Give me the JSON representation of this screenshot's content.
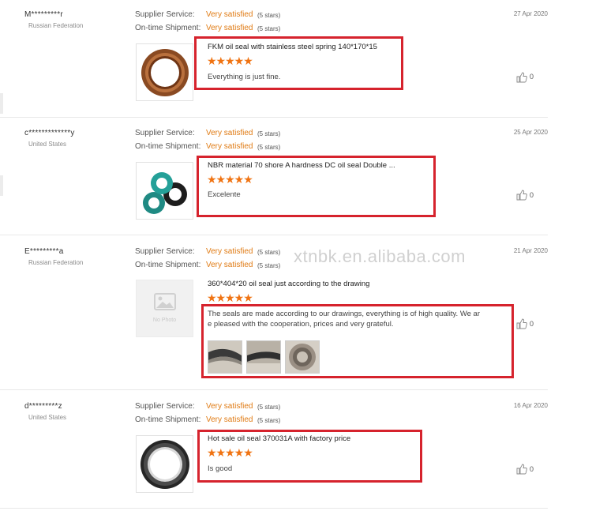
{
  "labels": {
    "supplier_service": "Supplier Service:",
    "ontime_shipment": "On-time Shipment:",
    "no_photo": "No Photo"
  },
  "watermark": "xtnbk.en.alibaba.com",
  "colors": {
    "accent": "#e07b14",
    "stars": "#f07312",
    "highlight": "#d6232d"
  },
  "reviews": [
    {
      "buyer": "M*********r",
      "country": "Russian Federation",
      "supplier_rating": "Very satisfied",
      "supplier_stars": "(5 stars)",
      "shipment_rating": "Very satisfied",
      "shipment_stars": "(5 stars)",
      "date": "27 Apr 2020",
      "product": "FKM oil seal with stainless steel spring 140*170*15",
      "rating": 5,
      "stars_text": "★★★★★",
      "comment": "Everything is just fine.",
      "likes": "0",
      "image_icon": "brown-oil-seal-photo"
    },
    {
      "buyer": "c*************y",
      "country": "United States",
      "supplier_rating": "Very satisfied",
      "supplier_stars": "(5 stars)",
      "shipment_rating": "Very satisfied",
      "shipment_stars": "(5 stars)",
      "date": "25 Apr 2020",
      "product": "NBR material 70 shore A hardness DC oil seal Double ...",
      "rating": 5,
      "stars_text": "★★★★★",
      "comment": "Excelente",
      "likes": "0",
      "image_icon": "green-oil-seals-photo"
    },
    {
      "buyer": "E*********a",
      "country": "Russian Federation",
      "supplier_rating": "Very satisfied",
      "supplier_stars": "(5 stars)",
      "shipment_rating": "Very satisfied",
      "shipment_stars": "(5 stars)",
      "date": "21 Apr 2020",
      "product": "360*404*20 oil seal just according to the drawing",
      "rating": 5,
      "stars_text": "★★★★★",
      "comment_line1": "The seals are made according to our drawings, everything is of high quality. We ar",
      "comment_line2": "e pleased with the cooperation, prices and very grateful.",
      "likes": "0",
      "image_icon": "no-photo-placeholder"
    },
    {
      "buyer": "d*********z",
      "country": "United States",
      "supplier_rating": "Very satisfied",
      "supplier_stars": "(5 stars)",
      "shipment_rating": "Very satisfied",
      "shipment_stars": "(5 stars)",
      "date": "16 Apr 2020",
      "product": "Hot sale oil seal 370031A with factory price",
      "rating": 5,
      "stars_text": "★★★★★",
      "comment": "Is good",
      "likes": "0",
      "image_icon": "black-oil-seal-photo"
    }
  ]
}
